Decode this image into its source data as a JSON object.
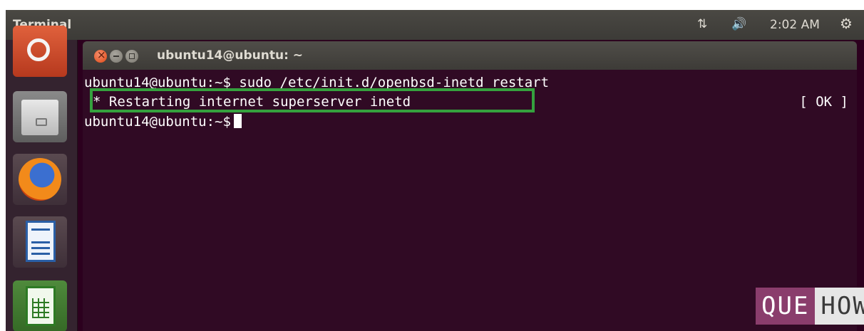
{
  "top_panel": {
    "app_name": "Terminal",
    "clock": "2:02 AM",
    "icons": [
      "network-icon",
      "volume-icon",
      "power-settings-icon"
    ]
  },
  "launcher": {
    "items": [
      {
        "name": "Dash",
        "icon": "ubuntu-dash-icon"
      },
      {
        "name": "Files",
        "icon": "files-icon"
      },
      {
        "name": "Firefox",
        "icon": "firefox-icon"
      },
      {
        "name": "LibreOffice Writer",
        "icon": "writer-icon"
      },
      {
        "name": "LibreOffice Calc",
        "icon": "calc-icon"
      }
    ]
  },
  "window": {
    "title": "ubuntu14@ubuntu: ~"
  },
  "terminal": {
    "line1": "ubuntu14@ubuntu:~$ sudo /etc/init.d/openbsd-inetd restart",
    "line2": "* Restarting internet superserver inetd",
    "status": "[ OK ]",
    "prompt": "ubuntu14@ubuntu:~$"
  },
  "watermark": {
    "left": "QUE",
    "right": "HOW"
  },
  "colors": {
    "terminal_bg": "#300a24",
    "highlight_border": "#35a13e",
    "panel_bg": "#3c3b37"
  }
}
